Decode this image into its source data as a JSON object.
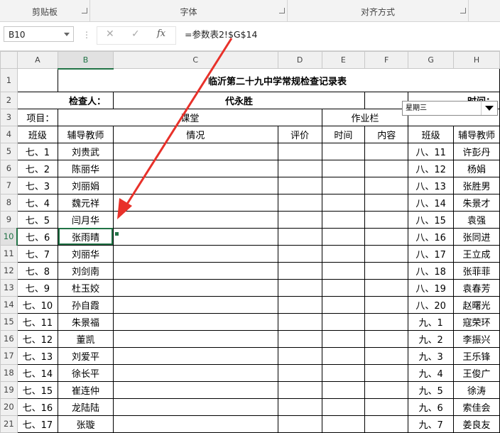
{
  "ribbon": {
    "groups": [
      {
        "label": "剪贴板"
      },
      {
        "label": "字体"
      },
      {
        "label": "对齐方式"
      }
    ]
  },
  "formula_bar": {
    "name_box": "B10",
    "cancel_icon": "✕",
    "enter_icon": "✓",
    "fx_label": "fx",
    "formula": "=参数表2!$G$14"
  },
  "columns": [
    "A",
    "B",
    "C",
    "D",
    "E",
    "F",
    "G",
    "H"
  ],
  "selected_column": "B",
  "selected_row": "10",
  "sheet": {
    "title": "临沂第二十九中学常规检查记录表",
    "inspector_label": "检查人：",
    "inspector_name": "代永胜",
    "time_label": "时间：",
    "item_label": "项目：",
    "classroom_label": "课堂",
    "homework_label": "作业栏",
    "weekday": "星期三",
    "headers": {
      "class": "班级",
      "teacher": "辅导教师",
      "situation": "情况",
      "evaluation": "评价",
      "time": "时间",
      "content": "内容",
      "class2": "班级",
      "teacher2": "辅导教师"
    },
    "rows": [
      {
        "row": "5",
        "cls": "七、1",
        "teacher": "刘贵武",
        "cls2": "八、11",
        "teacher2": "许彭丹"
      },
      {
        "row": "6",
        "cls": "七、2",
        "teacher": "陈丽华",
        "cls2": "八、12",
        "teacher2": "杨娟"
      },
      {
        "row": "7",
        "cls": "七、3",
        "teacher": "刘丽娟",
        "cls2": "八、13",
        "teacher2": "张胜男"
      },
      {
        "row": "8",
        "cls": "七、4",
        "teacher": "魏元祥",
        "cls2": "八、14",
        "teacher2": "朱景才"
      },
      {
        "row": "9",
        "cls": "七、5",
        "teacher": "闫月华",
        "cls2": "八、15",
        "teacher2": "袁强"
      },
      {
        "row": "10",
        "cls": "七、6",
        "teacher": "张雨晴",
        "cls2": "八、16",
        "teacher2": "张同进"
      },
      {
        "row": "11",
        "cls": "七、7",
        "teacher": "刘丽华",
        "cls2": "八、17",
        "teacher2": "王立成"
      },
      {
        "row": "12",
        "cls": "七、8",
        "teacher": "刘剑南",
        "cls2": "八、18",
        "teacher2": "张菲菲"
      },
      {
        "row": "13",
        "cls": "七、9",
        "teacher": "杜玉姣",
        "cls2": "八、19",
        "teacher2": "袁春芳"
      },
      {
        "row": "14",
        "cls": "七、10",
        "teacher": "孙自霞",
        "cls2": "八、20",
        "teacher2": "赵曙光"
      },
      {
        "row": "15",
        "cls": "七、11",
        "teacher": "朱景福",
        "cls2": "九、1",
        "teacher2": "寇荣环"
      },
      {
        "row": "16",
        "cls": "七、12",
        "teacher": "董凯",
        "cls2": "九、2",
        "teacher2": "李振兴"
      },
      {
        "row": "17",
        "cls": "七、13",
        "teacher": "刘爱平",
        "cls2": "九、3",
        "teacher2": "王乐锋"
      },
      {
        "row": "18",
        "cls": "七、14",
        "teacher": "徐长平",
        "cls2": "九、4",
        "teacher2": "王俊广"
      },
      {
        "row": "19",
        "cls": "七、15",
        "teacher": "崔连仲",
        "cls2": "九、5",
        "teacher2": "徐涛"
      },
      {
        "row": "20",
        "cls": "七、16",
        "teacher": "龙陆陆",
        "cls2": "九、6",
        "teacher2": "索佳会"
      },
      {
        "row": "21",
        "cls": "七、17",
        "teacher": "张璇",
        "cls2": "九、7",
        "teacher2": "姜良友"
      }
    ]
  },
  "colors": {
    "selection": "#217346",
    "annotation_arrow": "#e8312a"
  }
}
